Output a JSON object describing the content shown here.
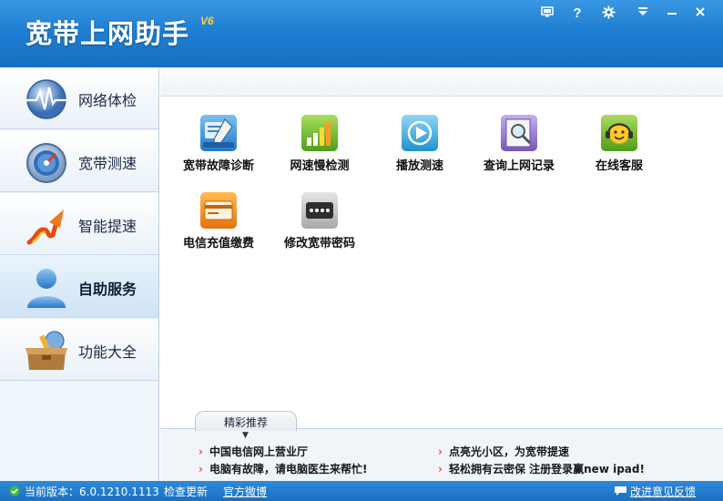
{
  "window": {
    "title": "宽带上网助手",
    "version": "V6",
    "controls": [
      "monitor-icon",
      "help-icon",
      "gear-icon",
      "menu-down-icon",
      "minimize-icon",
      "close-icon"
    ]
  },
  "sidebar": {
    "items": [
      {
        "label": "网络体检",
        "icon": "heartbeat-globe-icon",
        "active": false
      },
      {
        "label": "宽带测速",
        "icon": "speedometer-icon",
        "active": false
      },
      {
        "label": "智能提速",
        "icon": "rocket-arrow-icon",
        "active": false
      },
      {
        "label": "自助服务",
        "icon": "user-icon",
        "active": true
      },
      {
        "label": "功能大全",
        "icon": "toolbox-icon",
        "active": false
      }
    ]
  },
  "tools": [
    {
      "label": "宽带故障诊断",
      "icon": "diagnostic-tools-icon",
      "color": "#3a8fd6"
    },
    {
      "label": "网速慢检测",
      "icon": "signal-bars-icon",
      "color": "#6ab52a"
    },
    {
      "label": "播放测速",
      "icon": "play-icon",
      "color": "#2fa6d8"
    },
    {
      "label": "查询上网记录",
      "icon": "magnifier-document-icon",
      "color": "#8b6cc7"
    },
    {
      "label": "在线客服",
      "icon": "headset-smiley-icon",
      "color": "#6cb82d"
    },
    {
      "label": "电信充值缴费",
      "icon": "card-icon",
      "color": "#f08a1c"
    },
    {
      "label": "修改宽带密码",
      "icon": "password-icon",
      "color": "#555555"
    }
  ],
  "recommend": {
    "tab_label": "精彩推荐",
    "links": [
      "中国电信网上营业厅",
      "点亮光小区，为宽带提速",
      "电脑有故障，请电脑医生来帮忙!",
      "轻松拥有云密保 注册登录赢new ipad!"
    ]
  },
  "status": {
    "version_text": "当前版本：6.0.1210.1113",
    "check_update": "检查更新",
    "weibo": "官方微博",
    "feedback": "改进意见反馈"
  }
}
